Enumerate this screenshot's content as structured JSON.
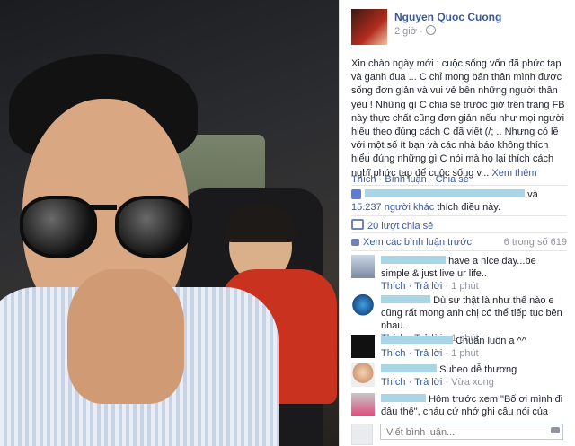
{
  "post": {
    "author": "Nguyen Quoc Cuong",
    "time": "2 giờ ·",
    "text": "Xin chào ngày mới ; cuộc sống vốn đã phức tạp và ganh đua ... C chỉ mong bản thân mình được sống đơn giản và vui vẻ bên những người thân yêu ! Những gì C chia sẻ trước giờ trên trang FB này thực chất cũng đơn giản nếu như mọi người hiểu theo đúng cách C đã viết (/; .. Nhưng có lẽ với một số ít bạn và các nhà báo không thích hiểu đúng những gì C nói mà họ lại thích cách nghĩ phức tạp để cuộc sống v...",
    "see_more": "Xem thêm"
  },
  "actions": {
    "like": "Thích",
    "comment": "Bình luận",
    "share": "Chia sẻ"
  },
  "likes": {
    "suffix": "và",
    "others": "15.237 người khác",
    "tail": "thích điều này."
  },
  "shares": "20 lượt chia sẻ",
  "comments_link": {
    "label": "Xem các bình luận trước",
    "count": "6 trong số 619"
  },
  "comments": [
    {
      "text": "have a nice day...be simple & just live ur life..",
      "like": "Thích",
      "reply": "Trả lời",
      "time": "1 phút"
    },
    {
      "text": "Dù sự thật là như thế nào e cũng rất mong anh chị có thể tiếp tục bên nhau.",
      "like": "Thích",
      "reply": "Trả lời",
      "time": "1 phút"
    },
    {
      "text": "Chuẩn luôn a ^^",
      "like": "Thích",
      "reply": "Trả lời",
      "time": "1 phút"
    },
    {
      "text": "Subeo dễ thương",
      "like": "Thích",
      "reply": "Trả lời",
      "time": "Vừa xong"
    },
    {
      "text": "Hôm trước xem \"Bố ơi mình đi đâu thế\", cháu cứ nhớ ghi câu nói của một ông bố:"
    }
  ],
  "reply": {
    "placeholder": "Viết bình luận..."
  },
  "colors": {
    "link": "#3b5998",
    "muted": "#90949c"
  }
}
